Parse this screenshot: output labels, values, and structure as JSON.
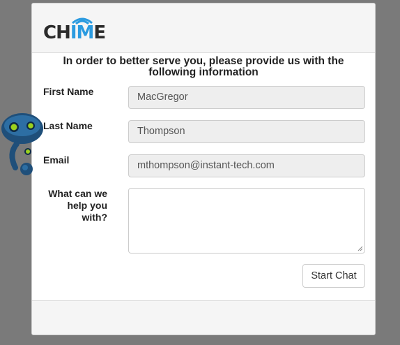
{
  "header": {
    "logo_text_pre": "CH",
    "logo_text_hl": "IM",
    "logo_text_post": "E"
  },
  "form": {
    "intro": "In order to better serve you, please provide us with the following information",
    "first_name": {
      "label": "First Name",
      "value": "MacGregor"
    },
    "last_name": {
      "label": "Last Name",
      "value": "Thompson"
    },
    "email": {
      "label": "Email",
      "value": "mthompson@instant-tech.com"
    },
    "question": {
      "label": "What can we help you with?",
      "value": ""
    },
    "submit_label": "Start Chat"
  },
  "colors": {
    "background": "#7a7a7a",
    "logo_accent": "#2b9be0",
    "robot_body": "#1f4f7a",
    "robot_eye": "#9bd11e"
  }
}
